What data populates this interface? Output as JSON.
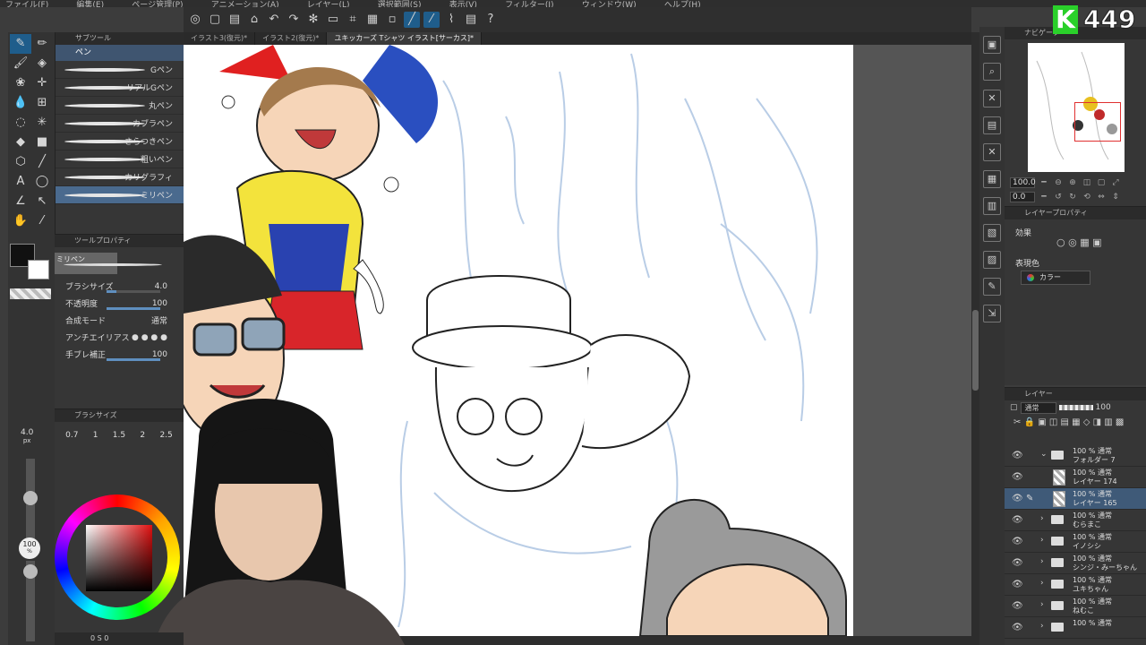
{
  "menu": {
    "items": [
      "ファイル(F)",
      "編集(E)",
      "ページ管理(P)",
      "アニメーション(A)",
      "レイヤー(L)",
      "選択範囲(S)",
      "表示(V)",
      "フィルター(I)",
      "ウィンドウ(W)",
      "ヘルプ(H)"
    ]
  },
  "tabs": [
    {
      "label": "イラスト3(復元)*",
      "active": false
    },
    {
      "label": "イラスト2(復元)*",
      "active": false
    },
    {
      "label": "ユキッカーズ Tシャツ イラスト[サーカス]*",
      "active": true
    }
  ],
  "subtool": {
    "header": "サブツール",
    "group": "ペン",
    "pens": [
      {
        "label": "Gペン",
        "selected": false
      },
      {
        "label": "リアルGペン",
        "selected": false
      },
      {
        "label": "丸ペン",
        "selected": false
      },
      {
        "label": "カブラペン",
        "selected": false
      },
      {
        "label": "さらつきペン",
        "selected": false
      },
      {
        "label": "粗いペン",
        "selected": false
      },
      {
        "label": "カリグラフィ",
        "selected": false
      },
      {
        "label": "ミリペン",
        "selected": true
      }
    ]
  },
  "tool_property": {
    "header": "ツールプロパティ",
    "tool_name": "ミリペン",
    "rows": [
      {
        "label": "ブラシサイズ",
        "value": "4.0",
        "level": 0.18
      },
      {
        "label": "不透明度",
        "value": "100",
        "level": 1.0
      },
      {
        "label": "合成モード",
        "value": "通常"
      },
      {
        "label": "アンチエイリアス",
        "value": ""
      },
      {
        "label": "手ブレ補正",
        "value": "100",
        "level": 1.0
      }
    ]
  },
  "brush_size": {
    "header": "ブラシサイズ",
    "current": "4.0",
    "unit": "px",
    "ticks": [
      "0.7",
      "1",
      "1.5",
      "2",
      "2.5"
    ],
    "opacity": "100",
    "opacity_unit": "%"
  },
  "navigator": {
    "header": "ナビゲーター",
    "zoom": "100.0",
    "rotation": "0.0"
  },
  "layer_property": {
    "header": "レイヤープロパティ",
    "effect_label": "効果",
    "expression_label": "表現色",
    "expression_value": "カラー"
  },
  "layers": {
    "header": "レイヤー",
    "blend": "通常",
    "opacity": "100",
    "rows": [
      {
        "line1": "100 % 通常",
        "line2": "フォルダー 7",
        "type": "folder",
        "open": true,
        "selected": false
      },
      {
        "line1": "100 % 通常",
        "line2": "レイヤー 174",
        "type": "layer",
        "selected": false
      },
      {
        "line1": "100 % 通常",
        "line2": "レイヤー 165",
        "type": "layer",
        "selected": true
      },
      {
        "line1": "100 % 通常",
        "line2": "むらまこ",
        "type": "folder",
        "selected": false
      },
      {
        "line1": "100 % 通常",
        "line2": "イノシシ",
        "type": "folder",
        "selected": false
      },
      {
        "line1": "100 % 通常",
        "line2": "シンジ・みーちゃん",
        "type": "folder",
        "selected": false
      },
      {
        "line1": "100 % 通常",
        "line2": "ユキちゃん",
        "type": "folder",
        "selected": false
      },
      {
        "line1": "100 % 通常",
        "line2": "ねむこ",
        "type": "folder",
        "selected": false
      },
      {
        "line1": "100 % 通常",
        "line2": "",
        "type": "folder",
        "selected": false
      }
    ]
  },
  "badge": {
    "letter": "K",
    "count": "449"
  },
  "status": {
    "values": [
      "0",
      "S",
      "0"
    ]
  },
  "colors": {
    "accent": "#1f5d8b",
    "selection": "#3f5a78",
    "badge": "#2ad02a"
  }
}
